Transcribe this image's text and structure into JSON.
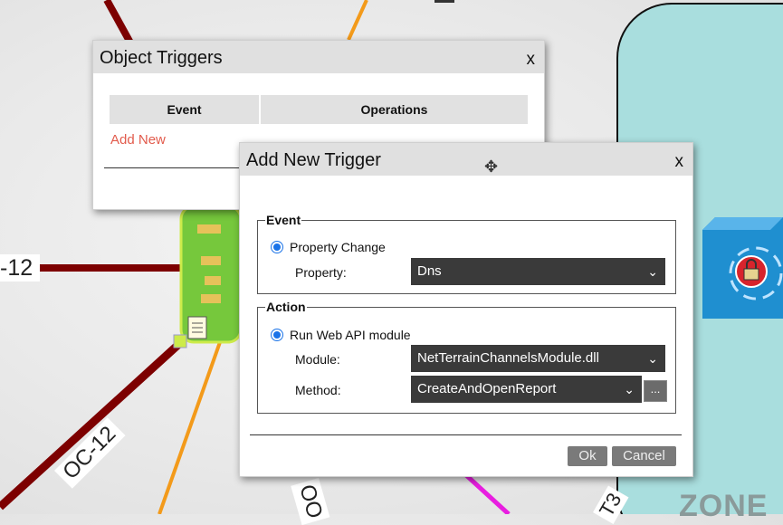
{
  "background": {
    "link_labels": {
      "left": "-12",
      "bottom_left": "OC-12",
      "bottom_mid": "OO",
      "bottom_right": "T3"
    },
    "zone_label": "ZONE"
  },
  "object_triggers": {
    "title": "Object Triggers",
    "close": "x",
    "columns": [
      "Event",
      "Operations"
    ],
    "add_new": "Add New"
  },
  "add_trigger": {
    "title": "Add New Trigger",
    "close": "x",
    "event": {
      "legend": "Event",
      "radio_label": "Property Change",
      "property_label": "Property:",
      "property_value": "Dns"
    },
    "action": {
      "legend": "Action",
      "radio_label": "Run Web API module",
      "module_label": "Module:",
      "module_value": "NetTerrainChannelsModule.dll",
      "method_label": "Method:",
      "method_value": "CreateAndOpenReport",
      "more_label": "..."
    },
    "ok": "Ok",
    "cancel": "Cancel"
  },
  "colors": {
    "link_dark_red": "#7d0000",
    "link_orange": "#f39a1a",
    "link_magenta": "#e81ee0",
    "zone_fill": "#a9dede",
    "accent_blue": "#1a73e8"
  }
}
